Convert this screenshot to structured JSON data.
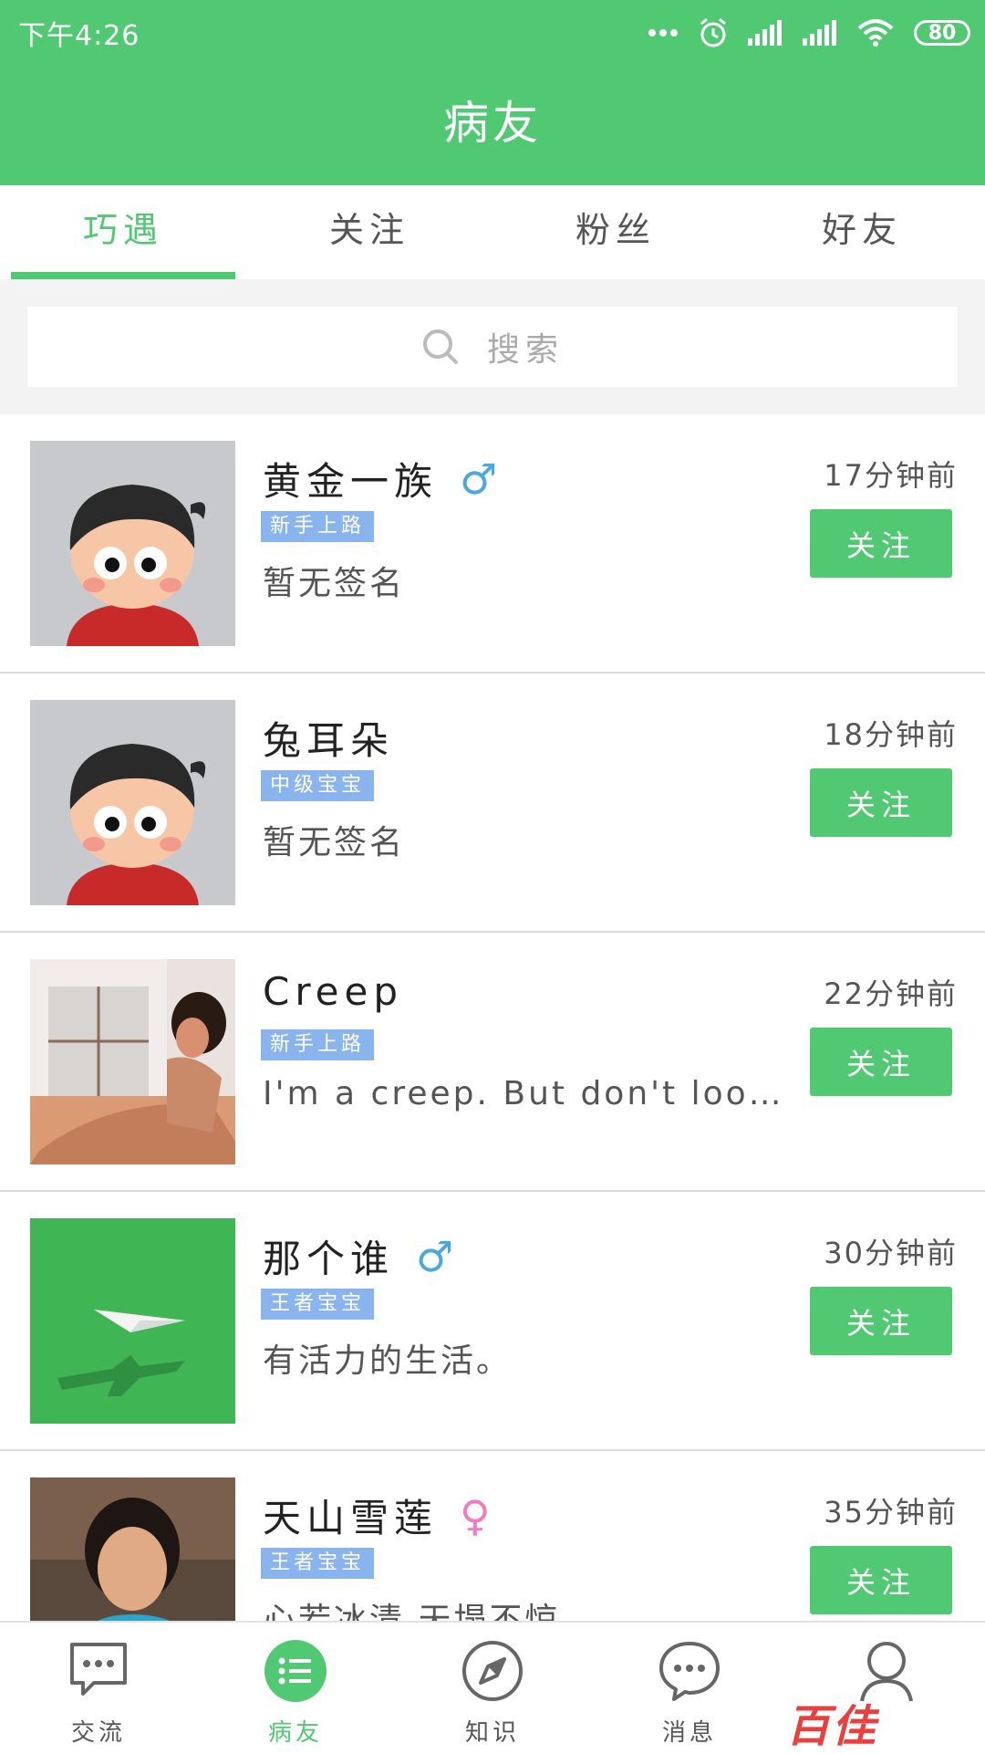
{
  "status": {
    "time": "下午4:26",
    "battery": "80"
  },
  "header": {
    "title": "病友"
  },
  "tabs": [
    {
      "label": "巧遇",
      "active": true
    },
    {
      "label": "关注",
      "active": false
    },
    {
      "label": "粉丝",
      "active": false
    },
    {
      "label": "好友",
      "active": false
    }
  ],
  "search": {
    "placeholder": "搜索"
  },
  "users": [
    {
      "name": "黄金一族",
      "gender": "♂",
      "badge": "新手上路",
      "signature": "暂无签名",
      "time": "17分钟前",
      "follow_label": "关注",
      "avatar": "cartoon-boy"
    },
    {
      "name": "兔耳朵",
      "gender": "",
      "badge": "中级宝宝",
      "signature": "暂无签名",
      "time": "18分钟前",
      "follow_label": "关注",
      "avatar": "cartoon-boy"
    },
    {
      "name": "Creep",
      "gender": "",
      "badge": "新手上路",
      "signature": "I'm a creep. But don't look b…",
      "time": "22分钟前",
      "follow_label": "关注",
      "avatar": "photo-window"
    },
    {
      "name": "那个谁",
      "gender": "♂",
      "badge": "王者宝宝",
      "signature": "有活力的生活。",
      "time": "30分钟前",
      "follow_label": "关注",
      "avatar": "paper-plane"
    },
    {
      "name": "天山雪莲",
      "gender": "♀",
      "badge": "王者宝宝",
      "signature": "心若冰清 天塌不惊",
      "time": "35分钟前",
      "follow_label": "关注",
      "avatar": "photo-woman"
    }
  ],
  "bottom_nav": [
    {
      "label": "交流",
      "icon": "chat-bubble-icon",
      "active": false
    },
    {
      "label": "病友",
      "icon": "list-icon",
      "active": true
    },
    {
      "label": "知识",
      "icon": "compass-icon",
      "active": false
    },
    {
      "label": "消息",
      "icon": "message-icon",
      "active": false
    },
    {
      "label": "",
      "icon": "profile-icon",
      "active": false
    }
  ],
  "watermark": "百佳",
  "colors": {
    "primary": "#51c972",
    "badge": "#89b4ee",
    "male": "#4aa8e0",
    "female": "#f07bc4"
  }
}
